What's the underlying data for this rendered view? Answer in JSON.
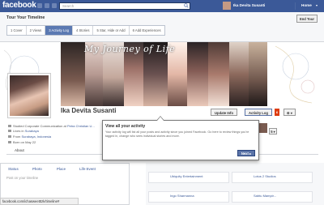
{
  "topbar": {
    "logo": "facebook",
    "search_placeholder": "Search",
    "profile_name": "Ika Devita Susanti",
    "home_label": "Home"
  },
  "tour": {
    "title": "Tour Your Timeline",
    "end_label": "End Tour",
    "steps": [
      {
        "label": "1 Cover"
      },
      {
        "label": "2 Views"
      },
      {
        "label": "3 Activity Log"
      },
      {
        "label": "4 Stories"
      },
      {
        "label": "5 Star, Hide or Add"
      },
      {
        "label": "6 Add Experiences"
      }
    ],
    "active_step": 2
  },
  "cover": {
    "overlay_text": "My Journey of Life"
  },
  "profile": {
    "name": "Ika Devita Susanti",
    "update_info_label": "Update Info",
    "activity_log_label": "Activity Log",
    "activity_count": "6",
    "gear_label": "⚙ ▾"
  },
  "info": {
    "lines": [
      {
        "prefix": "Studied Corporate Communication at ",
        "link": "Petra Christian U..."
      },
      {
        "prefix": "Lives in ",
        "link": "Surabaya"
      },
      {
        "prefix": "From ",
        "link": "Surabaya, Indonesia"
      },
      {
        "prefix": "Born on May 22",
        "link": ""
      }
    ],
    "about": "About"
  },
  "posts": {
    "tabs": [
      "Status",
      "Photo",
      "Place",
      "Life Event"
    ],
    "composer_placeholder": "Post on your timeline"
  },
  "right": {
    "cards": [
      "Ubiquity Entertainment",
      "Lotus 2 Studios",
      "Ingo Sharmanna",
      "Sabtu Mampir..."
    ]
  },
  "popup": {
    "title": "View all your activity",
    "body": "Your activity log will list all your posts and activity since you joined Facebook. Go here to review things you're tagged in, change who sees individual stories and more.",
    "next_label": "Next ▸"
  },
  "statusbar": {
    "url": "facebook.com/ichasweetttzk/timeline#"
  },
  "colors": {
    "brand": "#3b5998",
    "notification": "#dd3c10"
  }
}
